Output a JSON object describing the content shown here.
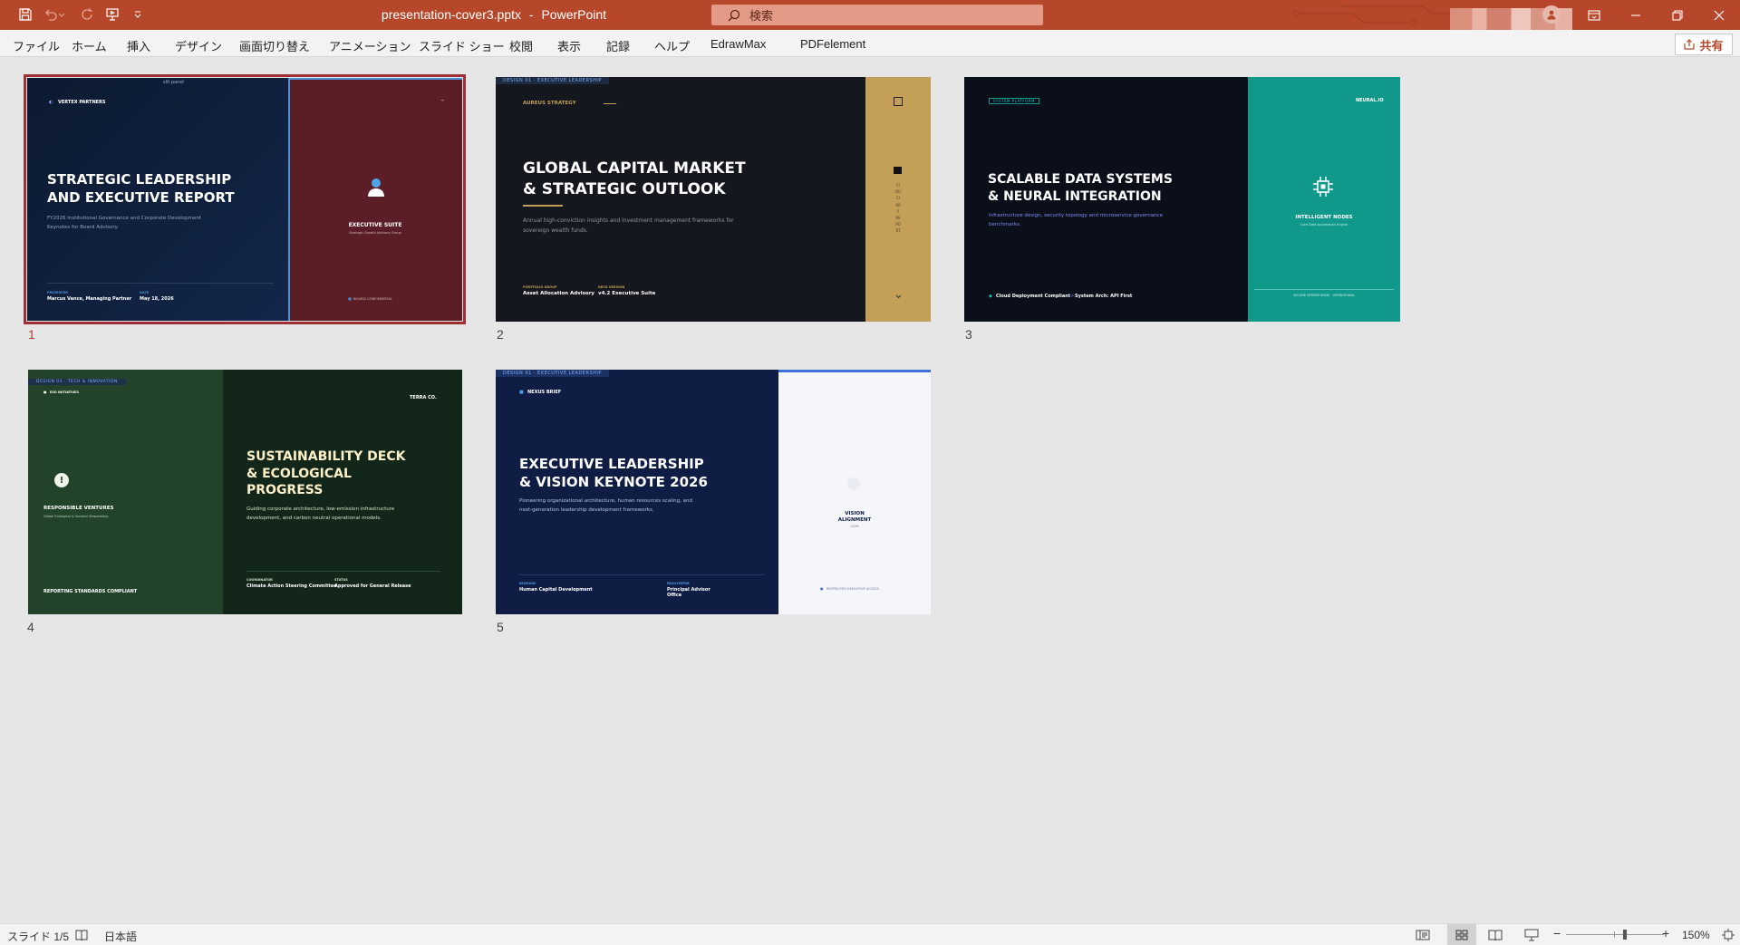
{
  "app": {
    "document_title": "presentation-cover3.pptx",
    "separator": "-",
    "app_name": "PowerPoint",
    "search_placeholder": "検索",
    "share_label": "共有"
  },
  "menu": [
    "ファイル",
    "ホーム",
    "挿入",
    "デザイン",
    "画面切り替え",
    "アニメーション",
    "スライド ショー",
    "校閲",
    "表示",
    "記録",
    "ヘルプ",
    "EdrawMax",
    "PDFelement"
  ],
  "slides": [
    {
      "number": "1",
      "top_note": "slit panel",
      "brand": "VERTEX PARTNERS",
      "title_line1": "STRATEGIC LEADERSHIP",
      "title_line2": " AND EXECUTIVE REPORT",
      "subtitle_line1": "FY2026 Institutional Governance and Corporate Development",
      "subtitle_line2": "Keynotes for Board Advisory.",
      "meta1_label": "PRESENTER",
      "meta1_value": "Marcus Vance, Managing Partner",
      "meta2_label": "DATE",
      "meta2_value": "May 18, 2026",
      "panel_title": "EXECUTIVE SUITE",
      "panel_sub": "Strategic Growth Advisory Group",
      "panel_footer": "BOARD CONFIDENTIAL"
    },
    {
      "number": "2",
      "tag": "DESIGN 01 · EXECUTIVE LEADERSHIP",
      "brand": "AUREUS STRATEGY",
      "title_line1": "GLOBAL CAPITAL MARKET",
      "title_line2": " & STRATEGIC OUTLOOK",
      "subtitle_line1": "Annual high-conviction insights and investment management frameworks for",
      "subtitle_line2": "sovereign wealth funds.",
      "meta1_label": "PORTFOLIO GROUP",
      "meta1_value": "Asset Allocation Advisory",
      "meta2_label": "DECK VERSION",
      "meta2_value": "v4.2 Executive Suite",
      "vertical_text": "FIDUCIARY REPORT"
    },
    {
      "number": "3",
      "tag": "SYSTEM PLATFORM",
      "brand": "NEURAL.IO",
      "title_line1": "SCALABLE DATA SYSTEMS",
      "title_line2": " & NEURAL INTEGRATION",
      "subtitle_line1": "Infrastructure design, security topology and microservice governance",
      "subtitle_line2": "benchmarks.",
      "meta1_value": "Cloud Deployment Compliant",
      "meta2_value": "System Arch: API First",
      "panel_title": "INTELLIGENT NODES",
      "panel_sub": "Core Data Automation Engine",
      "panel_footer": "SECURE SERVER NODE · OPERATIONAL"
    },
    {
      "number": "4",
      "tag": "DESIGN 03 · TECH & INNOVATION",
      "side_brand": "ESG INITIATIVES",
      "side_title": "RESPONSIBLE VENTURES",
      "side_sub": "Global Ecological & Societal Stewardship",
      "side_footer": "REPORTING STANDARDS COMPLIANT",
      "brand": "TERRA CO.",
      "title_line1": "SUSTAINABILITY DECK",
      "title_line2": " & ECOLOGICAL",
      "title_line3": "PROGRESS",
      "subtitle_line1": "Guiding corporate architecture, low-emission infrastructure",
      "subtitle_line2": "development, and carbon neutral operational models.",
      "meta1_label": "COORDINATOR",
      "meta1_value": "Climate Action Steering Committee",
      "meta2_label": "STATUS",
      "meta2_value": "Approved for General Release"
    },
    {
      "number": "5",
      "tag": "DESIGN 01 · EXECUTIVE LEADERSHIP",
      "brand": "NEXUS BRIEF",
      "title_line1": "EXECUTIVE LEADERSHIP",
      "title_line2": " & VISION KEYNOTE 2026",
      "subtitle_line1": "Pioneering organizational architecture, human resources scaling, and",
      "subtitle_line2": "next-generation leadership development frameworks.",
      "meta1_label": "DIVISION",
      "meta1_value": "Human Capital Development",
      "meta2_label": "FACILITATOR",
      "meta2_value_line1": "Principal Advisor",
      "meta2_value_line2": "Office",
      "panel_title_line1": "VISION",
      "panel_title_line2": "ALIGNMENT",
      "panel_sub": "2026",
      "panel_footer": "RESTRICTED EXECUTIVE ACCESS"
    }
  ],
  "status": {
    "slide_indicator": "スライド 1/5",
    "language": "日本語",
    "zoom": "150%",
    "zoom_level": 0.6
  },
  "colors": {
    "accent": "#b7472a",
    "selection": "#9e2f37",
    "s1_left": "#0e1c35",
    "s1_right": "#5b1e27",
    "s2_left": "#14171e",
    "s2_right": "#c49f57",
    "s3_left": "#0b0f1a",
    "s3_right": "#10998a",
    "s4_left": "#22432a",
    "s4_right": "#13261a",
    "s5_left": "#0f1c44",
    "s5_right": "#f4f6f9"
  }
}
